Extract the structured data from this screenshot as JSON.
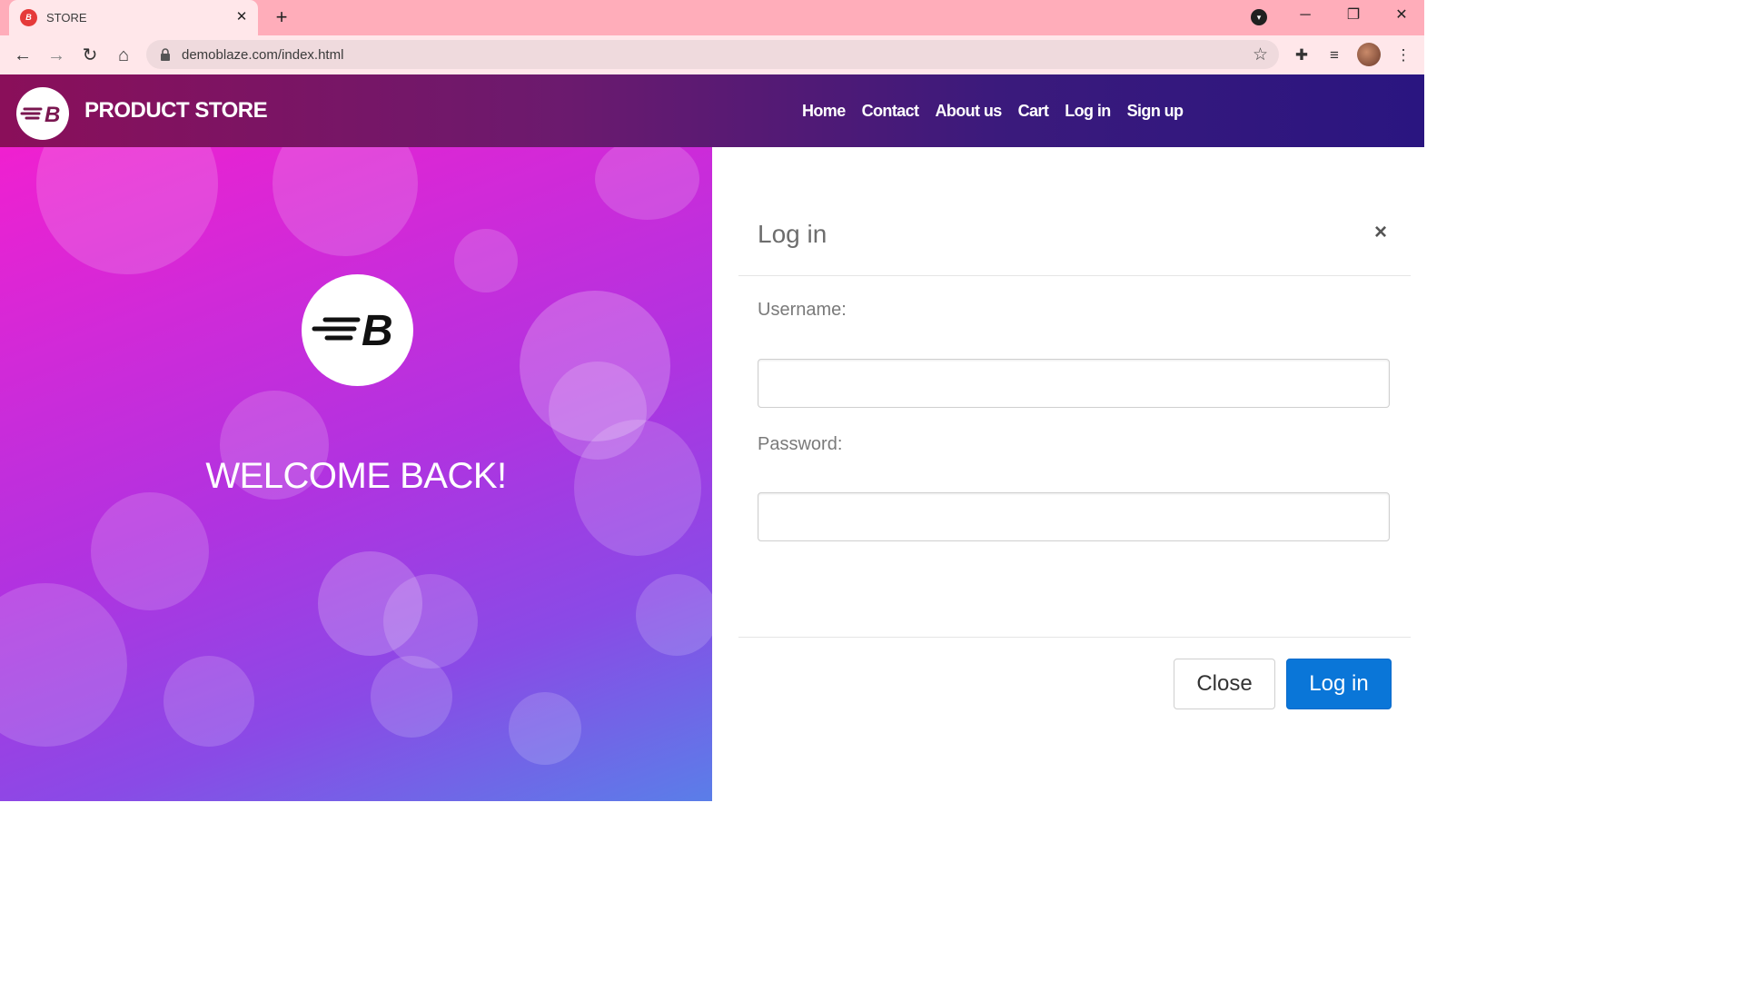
{
  "browser": {
    "tab_title": "STORE",
    "tab_favicon": "B",
    "tab_close": "✕",
    "new_tab": "+",
    "url": "demoblaze.com/index.html",
    "window_controls": {
      "minimize": "─",
      "restore": "❐",
      "close": "✕"
    }
  },
  "navbar": {
    "brand": "PRODUCT STORE",
    "links": [
      "Home",
      "Contact",
      "About us",
      "Cart",
      "Log in",
      "Sign up"
    ]
  },
  "hero": {
    "welcome": "WELCOME BACK!"
  },
  "modal": {
    "title": "Log in",
    "close_x": "×",
    "username_label": "Username:",
    "username_value": "",
    "password_label": "Password:",
    "password_value": "",
    "close_button": "Close",
    "login_button": "Log in"
  },
  "colors": {
    "tabbar": "#ffadba",
    "toolbar": "#ffe7ea",
    "primary_button": "#0a76d8"
  }
}
